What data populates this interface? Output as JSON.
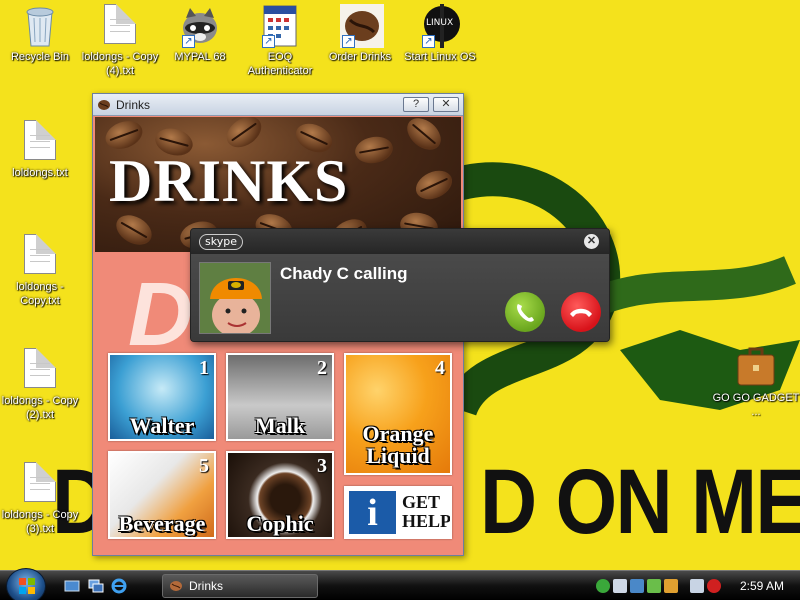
{
  "desktop": {
    "wallpaper_left_text": "D",
    "wallpaper_right_text": "D ON ME",
    "icons": [
      {
        "id": "recycle-bin",
        "label": "Recycle Bin"
      },
      {
        "id": "loldongs-copy4",
        "label": "loldongs - Copy (4).txt"
      },
      {
        "id": "mypal",
        "label": "MYPAL 68"
      },
      {
        "id": "eoq",
        "label": "EOQ Authenticator"
      },
      {
        "id": "order-drinks",
        "label": "Order Drinks"
      },
      {
        "id": "start-linux",
        "label": "Start Linux OS"
      },
      {
        "id": "loldongs",
        "label": "loldongs.txt"
      },
      {
        "id": "loldongs-copy",
        "label": "loldongs - Copy.txt"
      },
      {
        "id": "loldongs-copy2",
        "label": "loldongs - Copy (2).txt"
      },
      {
        "id": "loldongs-copy3",
        "label": "loldongs - Copy (3).txt"
      },
      {
        "id": "go-go-gadget",
        "label": "GO GO GADGET ..."
      }
    ],
    "linux_icon_text": "LINUX"
  },
  "drinks_window": {
    "title": "Drinks",
    "help_button": "?",
    "close_button": "✕",
    "banner_title": "DRINKS",
    "big_letter": "D",
    "tiles": [
      {
        "num": "1",
        "name": "Walter"
      },
      {
        "num": "2",
        "name": "Malk"
      },
      {
        "num": "4",
        "name": "Orange Liquid"
      },
      {
        "num": "5",
        "name": "Beverage"
      },
      {
        "num": "3",
        "name": "Cophic"
      }
    ],
    "help_tile": {
      "icon": "i",
      "text_line1": "GET",
      "text_line2": "HELP"
    }
  },
  "skype_popup": {
    "logo": "skype",
    "caller_text": "Chady C calling",
    "close_glyph": "✕"
  },
  "taskbar": {
    "window_button_label": "Drinks",
    "clock": "2:59 AM"
  },
  "colors": {
    "wallpaper": "#f4e21c",
    "window_bg": "#f08a78",
    "answer": "#6aa61e",
    "decline": "#d8131a"
  }
}
